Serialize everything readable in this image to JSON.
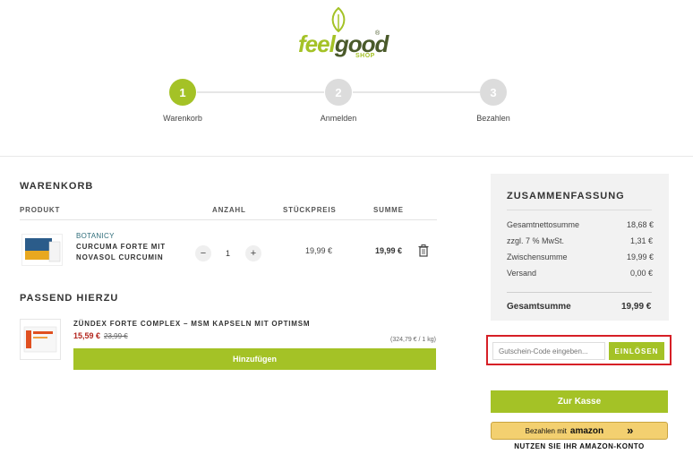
{
  "logo": {
    "part1": "feel",
    "part2": "good",
    "reg": "®",
    "shop": "SHOP"
  },
  "steps": [
    {
      "number": "1",
      "label": "Warenkorb",
      "active": true
    },
    {
      "number": "2",
      "label": "Anmelden",
      "active": false
    },
    {
      "number": "3",
      "label": "Bezahlen",
      "active": false
    }
  ],
  "cart": {
    "title": "WARENKORB",
    "headers": {
      "product": "PRODUKT",
      "quantity": "ANZAHL",
      "unit_price": "STÜCKPREIS",
      "sum": "SUMME"
    },
    "items": [
      {
        "brand": "BOTANICY",
        "name_line1": "CURCUMA FORTE MIT",
        "name_line2": "NOVASOL CURCUMIN",
        "minus": "−",
        "quantity": "1",
        "plus": "+",
        "unit_price": "19,99 €",
        "sum": "19,99 €"
      }
    ]
  },
  "recommendations": {
    "title": "PASSEND HIERZU",
    "items": [
      {
        "name": "ZÜNDEX FORTE COMPLEX – MSM KAPSELN MIT OPTIMSM",
        "price": "15,59 €",
        "old_price": "23,99 €",
        "unit_price": "(324,79 € / 1 kg)",
        "button": "Hinzufügen"
      }
    ]
  },
  "summary": {
    "title": "ZUSAMMENFASSUNG",
    "rows": [
      {
        "label": "Gesamtnettosumme",
        "value": "18,68 €"
      },
      {
        "label": "zzgl. 7 % MwSt.",
        "value": "1,31 €"
      },
      {
        "label": "Zwischensumme",
        "value": "19,99 €"
      },
      {
        "label": "Versand",
        "value": "0,00 €"
      }
    ],
    "total_label": "Gesamtsumme",
    "total_value": "19,99 €"
  },
  "coupon": {
    "placeholder": "Gutschein-Code eingeben...",
    "button": "EINLÖSEN"
  },
  "checkout_button": "Zur Kasse",
  "amazon": {
    "prefix": "Bezahlen mit",
    "brand": "amazon",
    "arrows": "»",
    "note": "NUTZEN SIE IHR AMAZON-KONTO"
  },
  "colors": {
    "accent": "#a4c226",
    "highlight_border": "#d61f26",
    "sale_price": "#b3261e"
  }
}
